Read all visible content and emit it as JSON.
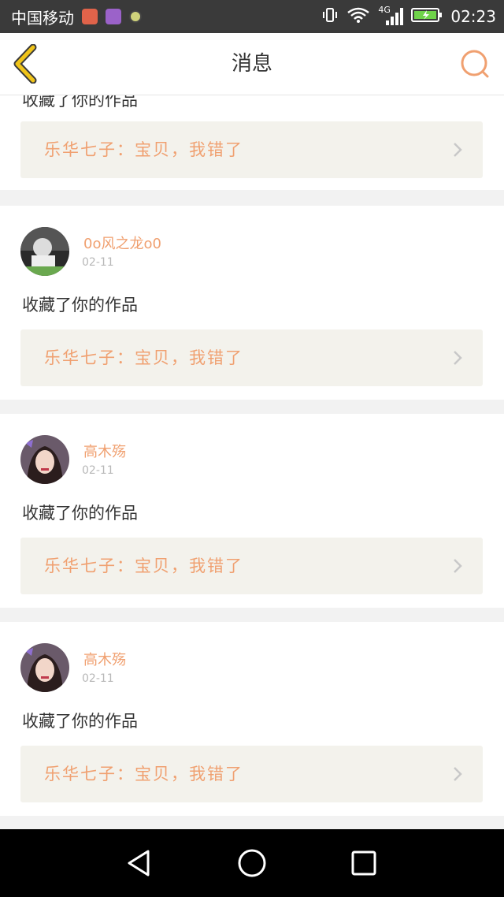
{
  "status_bar": {
    "carrier": "中国移动",
    "network": "4G",
    "time": "02:23",
    "colors": {
      "mail_app": "#e0634a",
      "gallery_app": "#9b62c9"
    }
  },
  "header": {
    "title": "消息",
    "back_icon": "chevron-left-icon",
    "search_icon": "search-icon",
    "accent_color": "#f0a070",
    "back_color": "#f0c419"
  },
  "top_partial": {
    "action": "收藏了你的作品",
    "work_title": "乐华七子：宝贝，我错了"
  },
  "notifications": [
    {
      "user": "0o风之龙o0",
      "date": "02-11",
      "action": "收藏了你的作品",
      "work_title": "乐华七子：宝贝，我错了"
    },
    {
      "user": "高木殇",
      "date": "02-11",
      "action": "收藏了你的作品",
      "work_title": "乐华七子：宝贝，我错了"
    },
    {
      "user": "高木殇",
      "date": "02-11",
      "action": "收藏了你的作品",
      "work_title": "乐华七子：宝贝，我错了"
    }
  ]
}
